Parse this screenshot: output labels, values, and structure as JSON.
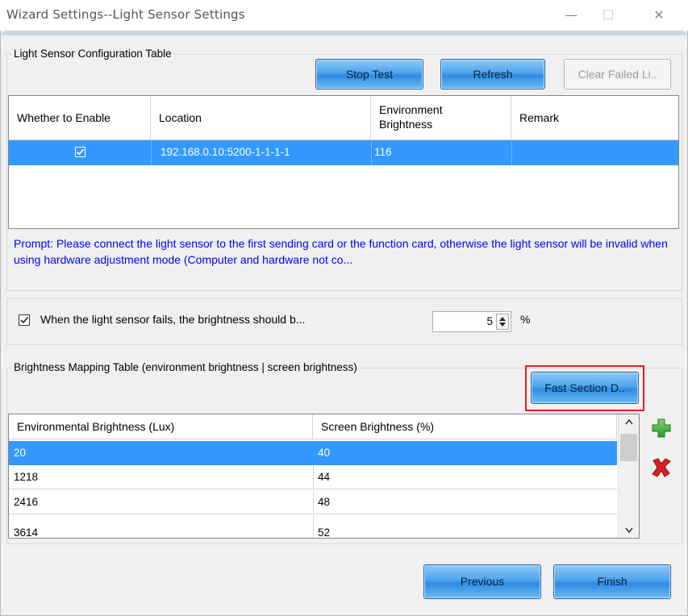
{
  "window": {
    "title": "Wizard Settings--Light Sensor Settings",
    "minimize": "—",
    "maximize": "☐",
    "close": "✕"
  },
  "sensor_group": {
    "legend": "Light Sensor Configuration Table",
    "stop_test": "Stop Test",
    "refresh": "Refresh",
    "clear_failed": "Clear Failed Li..",
    "columns": [
      "Whether to Enable",
      "Location",
      "Environment Brightness",
      "Remark"
    ],
    "rows": [
      {
        "enabled": true,
        "location": "192.168.0.10:5200-1-1-1-1",
        "brightness": "116",
        "remark": ""
      }
    ],
    "prompt": "Prompt: Please connect the light sensor to the first sending card or the function card, otherwise the light sensor will be invalid when using hardware adjustment mode (Computer and hardware not co..."
  },
  "failure": {
    "checked": true,
    "label": "When the light sensor fails, the brightness should b...",
    "value": "5",
    "unit": "%"
  },
  "mapping_group": {
    "legend": "Brightness Mapping Table (environment brightness | screen brightness)",
    "fast_section": "Fast Section D..",
    "columns": [
      "Environmental Brightness (Lux)",
      "Screen Brightness (%)"
    ],
    "rows": [
      {
        "env": "20",
        "screen": "40"
      },
      {
        "env": "1218",
        "screen": "44"
      },
      {
        "env": "2416",
        "screen": "48"
      },
      {
        "env": "3614",
        "screen": "52"
      }
    ]
  },
  "footer": {
    "previous": "Previous",
    "finish": "Finish"
  },
  "icons": {
    "add": "plus-icon",
    "delete": "x-icon",
    "add_color": "#2ea12e",
    "delete_color": "#d42020"
  }
}
